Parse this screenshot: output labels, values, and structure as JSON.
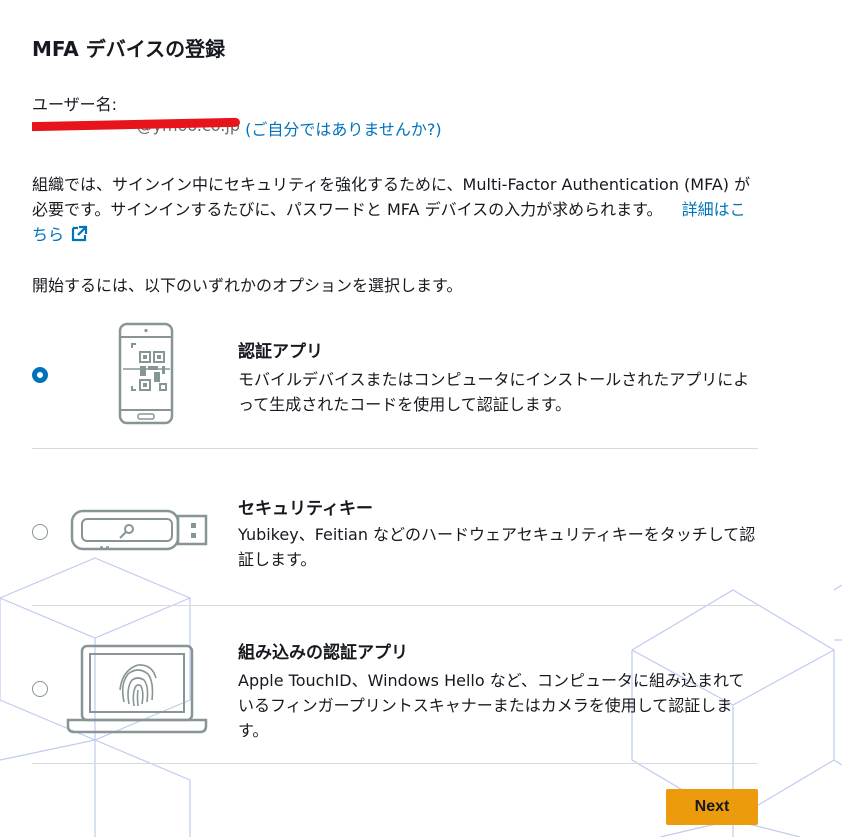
{
  "page": {
    "title": "MFA デバイスの登録"
  },
  "user": {
    "label": "ユーザー名:",
    "value_visible": "@ymoo.co.jp",
    "not_you_link": "(ご自分ではありませんか?)"
  },
  "description": {
    "text": "組織では、サインイン中にセキュリティを強化するために、Multi-Factor Authentication (MFA) が必要です。サインインするたびに、パスワードと MFA デバイスの入力が求められます。",
    "learn_more": "詳細はこちら"
  },
  "instruction": "開始するには、以下のいずれかのオプションを選択します。",
  "options": [
    {
      "title": "認証アプリ",
      "description": "モバイルデバイスまたはコンピュータにインストールされたアプリによって生成されたコードを使用して認証します。",
      "selected": true,
      "icon": "phone-qr-icon"
    },
    {
      "title": "セキュリティキー",
      "description": "Yubikey、Feitian などのハードウェアセキュリティキーをタッチして認証します。",
      "selected": false,
      "icon": "usb-key-icon"
    },
    {
      "title": "組み込みの認証アプリ",
      "description": "Apple TouchID、Windows Hello など、コンピュータに組み込まれているフィンガープリントスキャナーまたはカメラを使用して認証します。",
      "selected": false,
      "icon": "laptop-fingerprint-icon"
    }
  ],
  "actions": {
    "next_label": "Next"
  },
  "colors": {
    "link": "#0073bb",
    "radio_selected": "#0073bb",
    "primary_button": "#ec9b0d",
    "redaction": "#e8141b",
    "background_pattern": "#b9c6f0"
  }
}
